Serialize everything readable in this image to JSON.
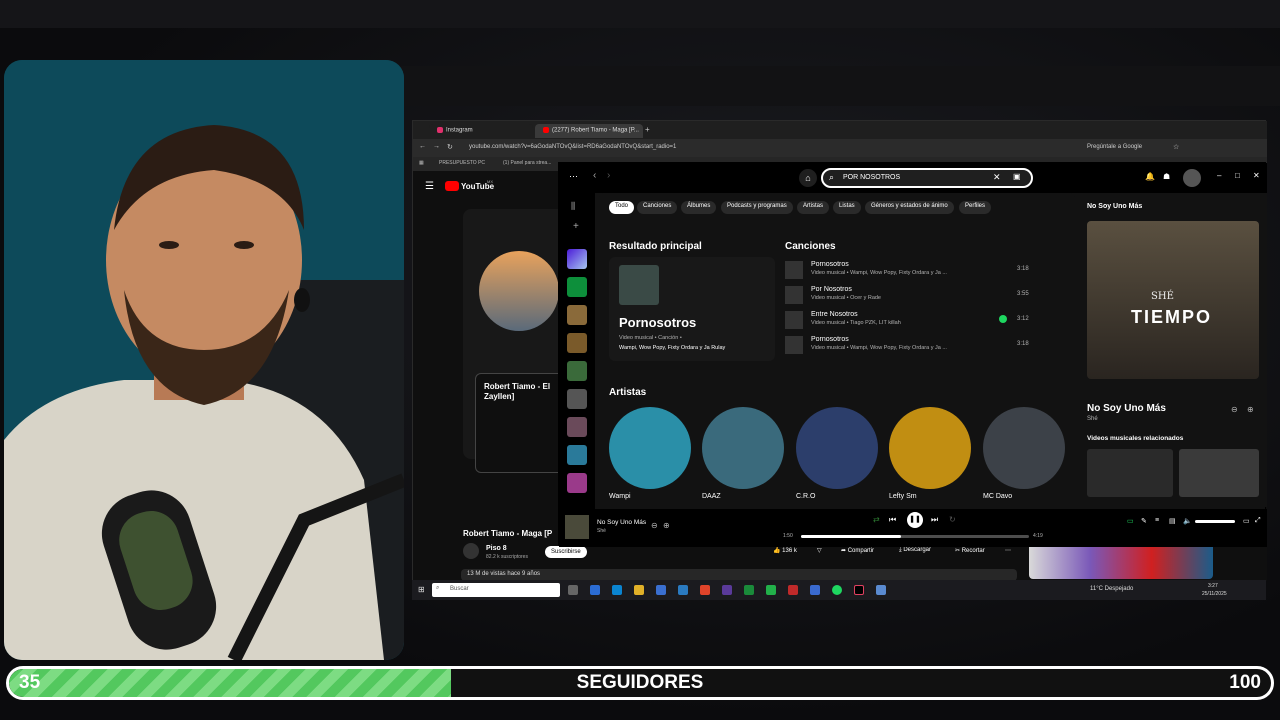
{
  "browser": {
    "tabs": [
      {
        "label": "Instagram"
      },
      {
        "label": "(2277) Robert Tiamo - Maga [P..."
      }
    ],
    "url": "youtube.com/watch?v=6aGodaNTOvQ&list=RD6aGodaNTOvQ&start_radio=1",
    "ask_google": "Pregúntale a Google",
    "bookmarks": [
      "PRESUPUESTO PC",
      "(1) Panel para strea..."
    ]
  },
  "youtube": {
    "logo_text": "YouTube",
    "logo_sup": "MX",
    "card_title": "Robert Tiamo - El Zayllen]",
    "video_title": "Robert Tiamo - Maga [P",
    "channel": "Piso 8",
    "subscribers": "82.2 k suscriptores",
    "subscribe_label": "Suscribirse",
    "views": "13 M de vistas  hace 9 años",
    "likes": "136 k",
    "share_label": "Compartir",
    "download_label": "Descargar",
    "clip_label": "Recortar"
  },
  "spotify": {
    "search_value": "POR NOSOTROS",
    "chips": [
      "Todo",
      "Canciones",
      "Álbumes",
      "Podcasts y programas",
      "Artistas",
      "Listas",
      "Géneros y estados de ánimo",
      "Perfiles"
    ],
    "top_result": {
      "heading": "Resultado principal",
      "title": "Pornosotros",
      "sub": "Video musical • Canción •",
      "artists": "Wampi, Wow Popy, Fixty Ordara y Ja Rulay"
    },
    "songs_heading": "Canciones",
    "songs": [
      {
        "title": "Pornosotros",
        "sub": "Video musical • Wampi, Wow Popy, Fixty Ordara y Ja ...",
        "duration": "3:18"
      },
      {
        "title": "Por Nosotros",
        "sub": "Video musical • Ocer y Rade",
        "duration": "3:55"
      },
      {
        "title": "Entre Nosotros",
        "sub": "Video musical • Tiago PZK, LIT killah",
        "duration": "3:12"
      },
      {
        "title": "Pornosotros",
        "sub": "Video musical • Wampi, Wow Popy, Fixty Ordara y Ja ...",
        "duration": "3:18"
      }
    ],
    "artists_heading": "Artistas",
    "artists": [
      {
        "name": "Wampi",
        "color": "#2a8fa8"
      },
      {
        "name": "DAAZ",
        "color": "#3a6a7c"
      },
      {
        "name": "C.R.O",
        "color": "#2c3e6b"
      },
      {
        "name": "Lefty Sm",
        "color": "#c18e12"
      },
      {
        "name": "MC Davo",
        "color": "#3c4148"
      }
    ],
    "now_playing_panel": {
      "header": "No Soy Uno Más",
      "cover_text": "TIEMPO",
      "cover_sub": "SHÉ",
      "title": "No Soy Uno Más",
      "artist": "Shé",
      "related": "Videos musicales relacionados"
    },
    "player": {
      "title": "No Soy Uno Más",
      "artist": "Shé",
      "elapsed": "1:50",
      "total": "4:19",
      "progress_fraction": 0.44
    }
  },
  "taskbar": {
    "search_placeholder": "Buscar",
    "weather": "11°C  Despejado",
    "time": "3:27",
    "date": "25/11/2025"
  },
  "overlay": {
    "progress_min": "35",
    "progress_label": "SEGUIDORES",
    "progress_max": "100",
    "progress_fraction": 0.35
  },
  "colors": {
    "spotify_green": "#1ed760",
    "progress_green": "#53c85e"
  }
}
